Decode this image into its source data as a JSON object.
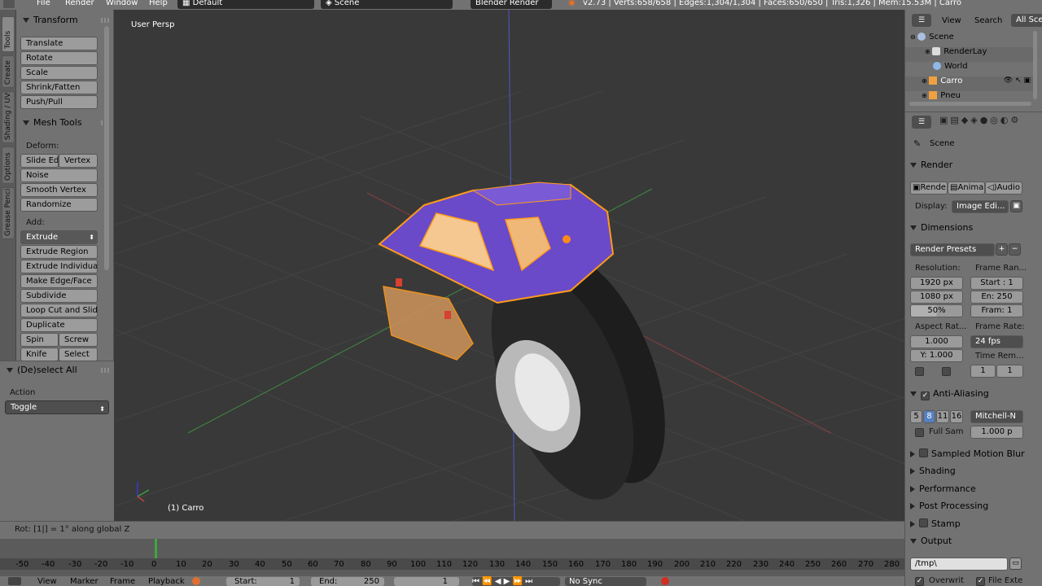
{
  "topbar": {
    "menu": [
      "File",
      "Render",
      "Window",
      "Help"
    ],
    "layout": "Default",
    "scene": "Scene",
    "engine": "Blender Render",
    "stats": "v2.73 | Verts:658/658 | Edges:1,304/1,304 | Faces:650/650 | Tris:1,326 | Mem:15.53M | Carro"
  },
  "vtabs": [
    "Tools",
    "Create",
    "Shading / UVs",
    "Options",
    "Grease Pencil"
  ],
  "toolshelf": {
    "transform_title": "Transform",
    "transform_buttons": [
      "Translate",
      "Rotate",
      "Scale",
      "Shrink/Fatten",
      "Push/Pull"
    ],
    "mesh_tools_title": "Mesh Tools",
    "deform_label": "Deform:",
    "slide_edge": "Slide Ed",
    "vertex": "Vertex",
    "noise": "Noise",
    "smooth_vertex": "Smooth Vertex",
    "randomize": "Randomize",
    "add_label": "Add:",
    "extrude": "Extrude",
    "add_buttons": [
      "Extrude Region",
      "Extrude Individual",
      "Make Edge/Face",
      "Subdivide",
      "Loop Cut and Slide",
      "Duplicate"
    ],
    "spin": "Spin",
    "screw": "Screw",
    "knife": "Knife",
    "select": "Select",
    "deselect_title": "(De)select All",
    "action_label": "Action",
    "action_value": "Toggle"
  },
  "viewport": {
    "view_label": "User Persp",
    "object_label": "(1) Carro"
  },
  "status": "Rot: [1|] = 1°  along global Z",
  "timeline": {
    "ticks": [
      "-50",
      "-40",
      "-30",
      "-20",
      "-10",
      "0",
      "10",
      "20",
      "30",
      "40",
      "50",
      "60",
      "70",
      "80",
      "90",
      "100",
      "110",
      "120",
      "130",
      "140",
      "150",
      "160",
      "170",
      "180",
      "190",
      "200",
      "210",
      "220",
      "230",
      "240",
      "250",
      "260",
      "270",
      "280"
    ],
    "current_frame": 0
  },
  "bottombar": {
    "view": "View",
    "marker": "Marker",
    "frame": "Frame",
    "playback": "Playback",
    "start": "Start:",
    "start_val": "1",
    "end": "End:",
    "end_val": "250",
    "current": "1",
    "sync": "No Sync"
  },
  "outliner": {
    "view": "View",
    "search": "Search",
    "all_scenes": "All Sce",
    "rows": [
      "Scene",
      "RenderLay",
      "World",
      "Carro",
      "Pneu"
    ]
  },
  "props": {
    "scene_label": "Scene",
    "render_title": "Render",
    "render_btn": "Rende",
    "anim_btn": "Anima",
    "audio_btn": "Audio",
    "display_label": "Display:",
    "display_value": "Image Edi...",
    "dimensions_title": "Dimensions",
    "render_presets": "Render Presets",
    "resolution_label": "Resolution:",
    "frame_range_label": "Frame Ran...",
    "res_x": "1920 px",
    "res_y": "1080 px",
    "res_pct": "50%",
    "start": "Start : 1",
    "end": "En: 250",
    "step": "Fram: 1",
    "aspect_label": "Aspect Rat...",
    "frame_rate_label": "Frame Rate:",
    "aspect_x": "1.000",
    "aspect_y": "Y: 1.000",
    "fps": "24 fps",
    "time_remap_label": "Time Rem...",
    "remap_old": "1",
    "remap_new": "1",
    "aa_title": "Anti-Aliasing",
    "aa_samples": [
      "5",
      "8",
      "11",
      "16"
    ],
    "aa_selected": "8",
    "aa_filter": "Mitchell-N",
    "full_sample": "Full Sam",
    "filter_size": "1.000 p",
    "motion_blur": "Sampled Motion Blur",
    "shading": "Shading",
    "performance": "Performance",
    "post_processing": "Post Processing",
    "stamp": "Stamp",
    "output": "Output",
    "output_path": "/tmp\\",
    "overwrite": "Overwrit",
    "file_ext": "File Exte"
  }
}
